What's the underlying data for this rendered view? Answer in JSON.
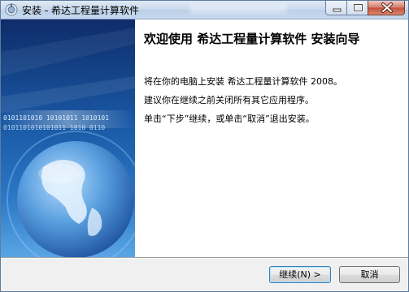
{
  "window": {
    "title": "安装 - 希达工程量计算软件"
  },
  "content": {
    "heading": "欢迎使用 希达工程量计算软件 安装向导",
    "line1": "将在你的电脑上安装 希达工程量计算软件 2008。",
    "line2": "建议你在继续之前关闭所有其它应用程序。",
    "line3": "单击“下步”继续，或单击“取消”退出安装。",
    "banner_binary": [
      "0101101010 10101011 1010101",
      "0101101010101011 1010 0110"
    ]
  },
  "buttons": {
    "next": "继续(N) >",
    "cancel": "取消"
  },
  "colors": {
    "title_bar": "#c9d9ec",
    "banner_dark": "#123a78",
    "banner_light": "#6fb0e6"
  }
}
